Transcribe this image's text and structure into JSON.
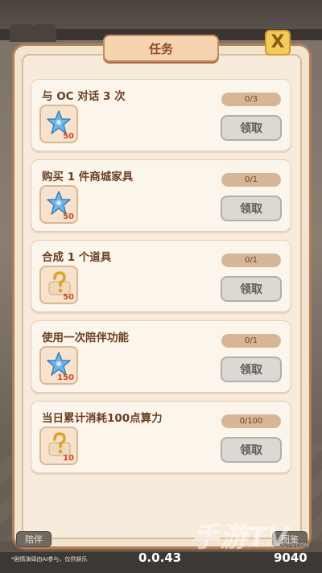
{
  "modal": {
    "title": "任务",
    "close_label": "X"
  },
  "tasks": [
    {
      "title": "与 OC 对话 3 次",
      "progress": "0/3",
      "claim_label": "领取",
      "reward_icon": "blue-star-icon",
      "reward_count": "50"
    },
    {
      "title": "购买 1 件商城家具",
      "progress": "0/1",
      "claim_label": "领取",
      "reward_icon": "blue-star-icon",
      "reward_count": "50"
    },
    {
      "title": "合成 1 个道具",
      "progress": "0/1",
      "claim_label": "领取",
      "reward_icon": "mystery-item-icon",
      "reward_count": "50"
    },
    {
      "title": "使用一次陪伴功能",
      "progress": "0/1",
      "claim_label": "领取",
      "reward_icon": "blue-star-icon",
      "reward_count": "150"
    },
    {
      "title": "当日累计消耗100点算力",
      "progress": "0/100",
      "claim_label": "领取",
      "reward_icon": "mystery-item-icon",
      "reward_count": "10"
    }
  ],
  "footer": {
    "companion_label": "陪伴",
    "collect_label": "图鉴",
    "disclaimer": "*剧情演绎由AI参与，仅供娱乐",
    "version": "0.0.43",
    "score": "9040"
  },
  "watermark": {
    "text": "手游TV",
    "sub": "WWW.SHOUYOUTV.COM"
  },
  "colors": {
    "panel": "#f2e4cf",
    "card": "#fbf5ec",
    "accent": "#c78a5e",
    "close_button": "#f2cb5a",
    "star": "#6fb6ea"
  }
}
